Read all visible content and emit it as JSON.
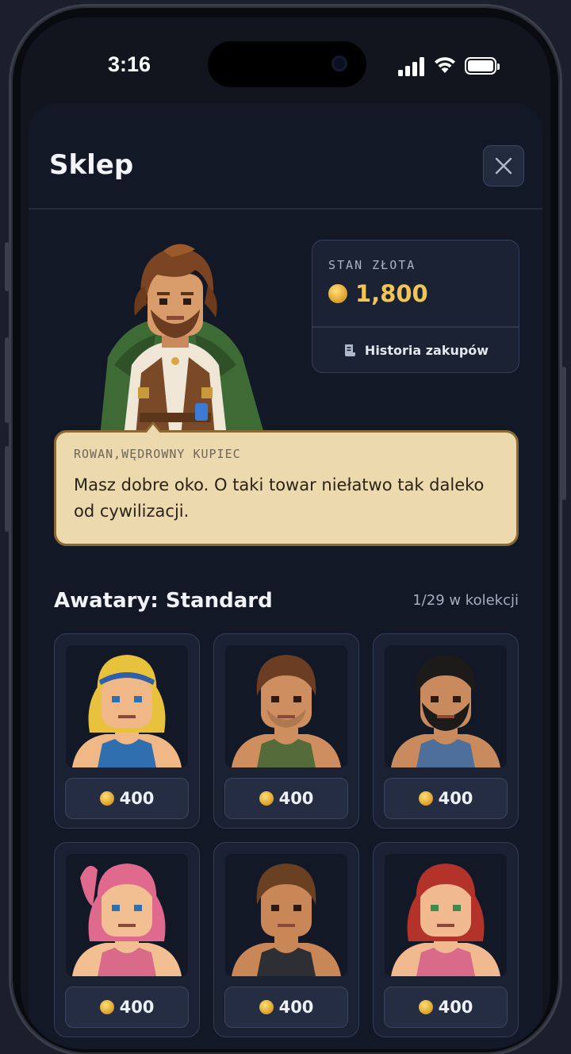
{
  "status_bar": {
    "time": "3:16"
  },
  "shop": {
    "title": "Sklep",
    "gold": {
      "label": "STAN ZŁOTA",
      "amount": "1,800"
    },
    "history_label": "Historia zakupów",
    "dialogue": {
      "speaker": "ROWAN,WĘDROWNY KUPIEC",
      "text": "Masz dobre oko. O taki towar niełatwo tak daleko od cywilizacji."
    },
    "section": {
      "title": "Awatary: Standard",
      "count": "1/29 w kolekcji"
    },
    "avatars": [
      {
        "price": "400",
        "hair": "#e8c23c",
        "skin": "#f0b887",
        "shirt": "#2f6fb0",
        "style": "blonde-headband"
      },
      {
        "price": "400",
        "hair": "#6b3d22",
        "skin": "#cf8e5f",
        "shirt": "#546b3a",
        "style": "short-brown-stubble"
      },
      {
        "price": "400",
        "hair": "#1d1b1a",
        "skin": "#c98a5e",
        "shirt": "#4d6f9a",
        "style": "dark-beard"
      },
      {
        "price": "400",
        "hair": "#e06a8e",
        "skin": "#f2bf92",
        "shirt": "#d96a8a",
        "style": "pink-ponytail"
      },
      {
        "price": "400",
        "hair": "#6a4022",
        "skin": "#c98656",
        "shirt": "#2e2f34",
        "style": "brown-short"
      },
      {
        "price": "400",
        "hair": "#b3332b",
        "skin": "#f0b98f",
        "shirt": "#d96a8a",
        "style": "red-curly"
      }
    ]
  }
}
